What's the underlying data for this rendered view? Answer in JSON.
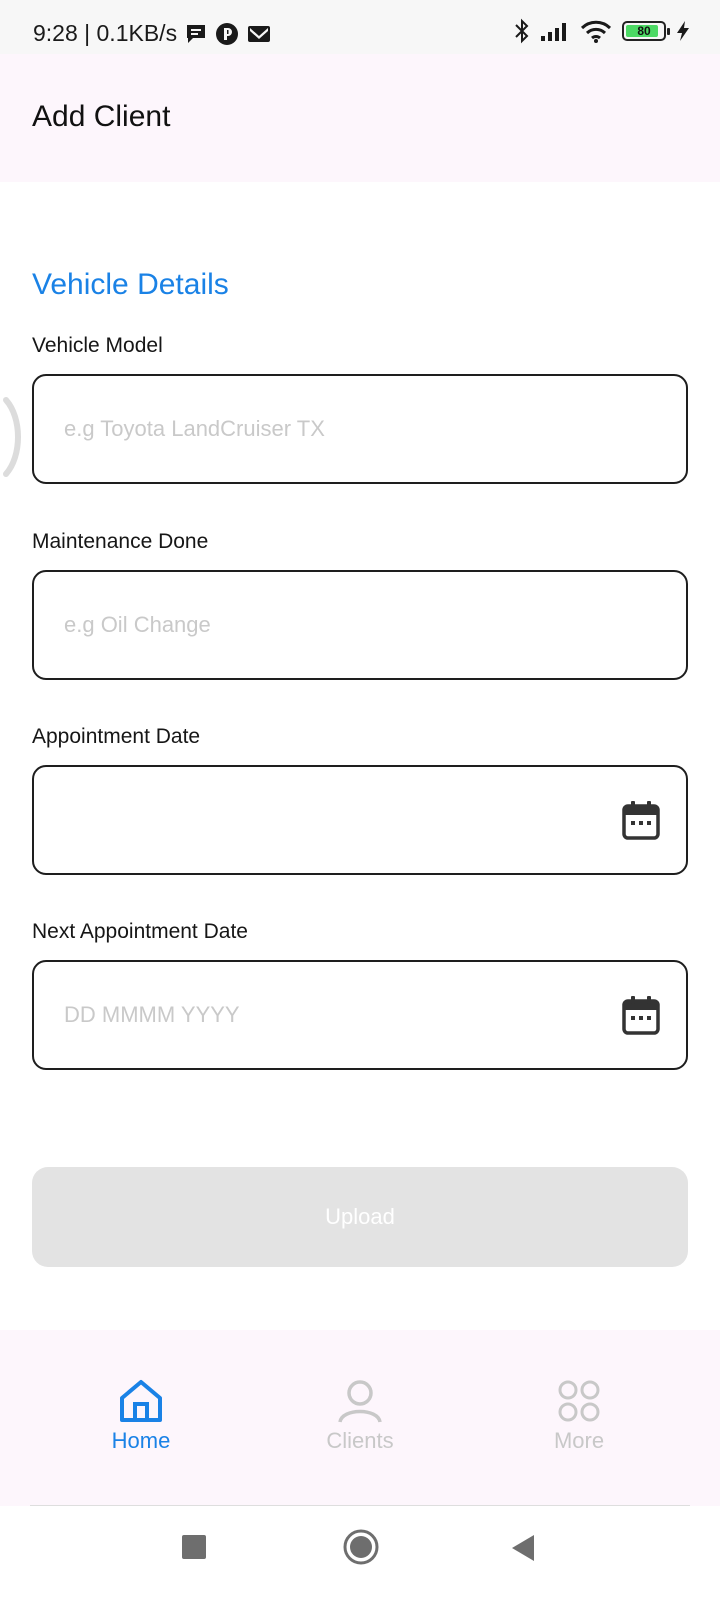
{
  "status_bar": {
    "time_speed": "9:28 | 0.1KB/s",
    "battery_level": "80",
    "icons": [
      "chat-icon",
      "p-badge-icon",
      "mail-icon",
      "bluetooth-icon",
      "signal-icon",
      "wifi-icon",
      "battery-icon",
      "charging-icon"
    ]
  },
  "header": {
    "title": "Add Client"
  },
  "form": {
    "section_title": "Vehicle Details",
    "vehicle_model": {
      "label": "Vehicle Model",
      "placeholder": "e.g Toyota LandCruiser TX",
      "value": ""
    },
    "maintenance_done": {
      "label": "Maintenance Done",
      "placeholder": "e.g Oil Change",
      "value": ""
    },
    "appointment_date": {
      "label": "Appointment Date",
      "placeholder": "",
      "value": ""
    },
    "next_appointment_date": {
      "label": "Next Appointment Date",
      "placeholder": "DD MMMM YYYY",
      "value": ""
    },
    "upload_label": "Upload"
  },
  "bottom_nav": {
    "active_color": "#1a82e6",
    "inactive_color": "#c8c8c8",
    "items": [
      {
        "label": "Home",
        "icon": "home-icon",
        "active": true
      },
      {
        "label": "Clients",
        "icon": "user-icon",
        "active": false
      },
      {
        "label": "More",
        "icon": "grid-circles-icon",
        "active": false
      }
    ]
  },
  "system_nav": {
    "icons": [
      "recents-square-icon",
      "home-circle-icon",
      "back-triangle-icon"
    ]
  }
}
